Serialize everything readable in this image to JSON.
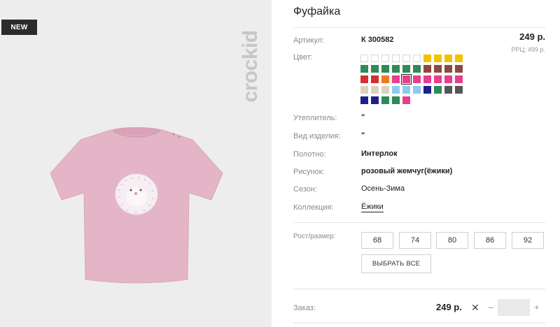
{
  "product": {
    "badge": "NEW",
    "brand": "crockid",
    "title": "Фуфайка",
    "price": "249 р.",
    "rrp": "РРЦ: 499 р."
  },
  "details": {
    "article_label": "Артикул:",
    "article_value": "К 300582",
    "color_label": "Цвет:",
    "insulation_label": "Утеплитель:",
    "insulation_value": "\"",
    "type_label": "Вид изделия:",
    "type_value": "\"",
    "fabric_label": "Полотно:",
    "fabric_value": "Интерлок",
    "print_label": "Рисунок:",
    "print_value": "розовый жемчуг(ёжики)",
    "season_label": "Сезон:",
    "season_value": "Осень-Зима",
    "collection_label": "Коллекция:",
    "collection_value": "Ёжики"
  },
  "swatches": [
    [
      "#ffffff",
      "#ffffff",
      "#ffffff",
      "#ffffff",
      "#ffffff",
      "#ffffff",
      "#f2c200",
      "#f2c200",
      "#f2c200",
      "#f2c200"
    ],
    [
      "#2e8b57",
      "#2e8b57",
      "#2e8b57",
      "#2e8b57",
      "#2e8b57",
      "#2e8b57",
      "#8b4a3c",
      "#8b4a3c",
      "#8b4a3c",
      "#8b4a3c"
    ],
    [
      "#d22f2f",
      "#d22f2f",
      "#f07a1a",
      "#e83e8c",
      "#e83e8c",
      "#e83e8c",
      "#e83e8c",
      "#e83e8c",
      "#e83e8c",
      "#e83e8c"
    ],
    [
      "#ddd0bc",
      "#ddd0bc",
      "#ddd0bc",
      "#8ec9f0",
      "#8ec9f0",
      "#8ec9f0",
      "#1f1f8a",
      "#2e8b57",
      "#555555",
      "#555555"
    ],
    [
      "#1f1f8a",
      "#1f1f8a",
      "#2e8b57",
      "#2e8b57",
      "#e83e8c"
    ]
  ],
  "selected_swatch": "2-4",
  "sizes": {
    "label": "Рост/размер:",
    "options": [
      "68",
      "74",
      "80",
      "86",
      "92"
    ],
    "select_all": "ВЫБРАТЬ ВСЕ"
  },
  "order": {
    "label": "Заказ:",
    "price": "249 р.",
    "times_symbol": "✕",
    "minus_symbol": "−",
    "plus_symbol": "+",
    "quantity": ""
  },
  "icons": {
    "remove": "close-icon",
    "decrement": "minus-icon",
    "increment": "plus-icon"
  }
}
